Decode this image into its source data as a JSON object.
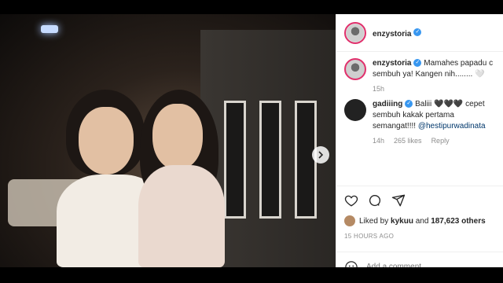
{
  "post": {
    "author": "enzystoria",
    "caption": "Mamahes papadu c sembuh ya! Kangen nih........ 🤍",
    "caption_time": "15h",
    "comment": {
      "user": "gadiiing",
      "text": "Baliii 🖤🖤🖤 cepet sembuh kakak pertama semangat!!!! ",
      "mention": "@hestipurwadinata",
      "time": "14h",
      "likes": "265 likes",
      "reply": "Reply"
    },
    "liked_by_prefix": "Liked by ",
    "liked_by_user": "kykuu",
    "liked_by_and": " and ",
    "liked_by_count": "187,623 others",
    "posted": "15 HOURS AGO",
    "add_comment_placeholder": "Add a comment..."
  },
  "icons": {
    "heart": "heart-icon",
    "comment": "comment-icon",
    "share": "share-icon",
    "emoji": "emoji-icon",
    "next": "chevron-right-icon",
    "verified": "verified-badge-icon"
  },
  "colors": {
    "verified": "#3897f0",
    "story_ring": "#e1306c",
    "text": "#262626",
    "muted": "#8e8e8e"
  }
}
